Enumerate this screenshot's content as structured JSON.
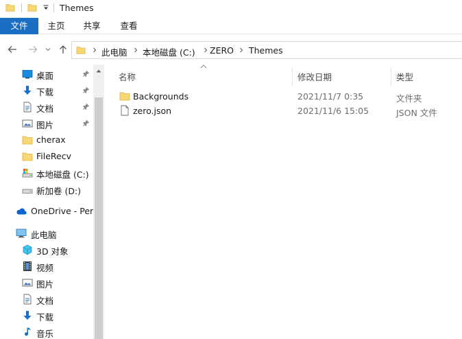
{
  "window": {
    "title": "Themes"
  },
  "ribbon": {
    "tabs": [
      {
        "label": "文件"
      },
      {
        "label": "主页"
      },
      {
        "label": "共享"
      },
      {
        "label": "查看"
      }
    ]
  },
  "address": {
    "crumbs": [
      "此电脑",
      "本地磁盘 (C:)",
      "ZERO",
      "Themes"
    ]
  },
  "sidebar": {
    "quick_access": [
      {
        "label": "桌面",
        "icon": "desktop-icon",
        "pinned": true
      },
      {
        "label": "下载",
        "icon": "download-icon",
        "pinned": true
      },
      {
        "label": "文档",
        "icon": "document-icon",
        "pinned": true
      },
      {
        "label": "图片",
        "icon": "picture-icon",
        "pinned": true
      },
      {
        "label": "cherax",
        "icon": "folder-icon",
        "pinned": false
      },
      {
        "label": "FileRecv",
        "icon": "folder-icon",
        "pinned": false
      },
      {
        "label": "本地磁盘 (C:)",
        "icon": "drive-icon",
        "pinned": false
      },
      {
        "label": "新加卷 (D:)",
        "icon": "drive-icon",
        "pinned": false
      }
    ],
    "onedrive": {
      "label": "OneDrive - Pers",
      "icon": "cloud-icon"
    },
    "this_pc": {
      "label": "此电脑",
      "icon": "computer-icon",
      "items": [
        {
          "label": "3D 对象",
          "icon": "3d-objects-icon"
        },
        {
          "label": "视频",
          "icon": "video-icon"
        },
        {
          "label": "图片",
          "icon": "picture-icon"
        },
        {
          "label": "文档",
          "icon": "document-icon"
        },
        {
          "label": "下载",
          "icon": "download-icon"
        },
        {
          "label": "音乐",
          "icon": "music-icon"
        }
      ]
    }
  },
  "filelist": {
    "columns": {
      "name": "名称",
      "date": "修改日期",
      "type": "类型"
    },
    "rows": [
      {
        "name": "Backgrounds",
        "date": "2021/11/7 0:35",
        "type": "文件夹",
        "icon": "folder-icon"
      },
      {
        "name": "zero.json",
        "date": "2021/11/6 15:05",
        "type": "JSON 文件",
        "icon": "file-icon"
      }
    ]
  },
  "colors": {
    "accent": "#1a6fc4",
    "folder": "#f8d775",
    "folder_dark": "#e8b84a"
  }
}
